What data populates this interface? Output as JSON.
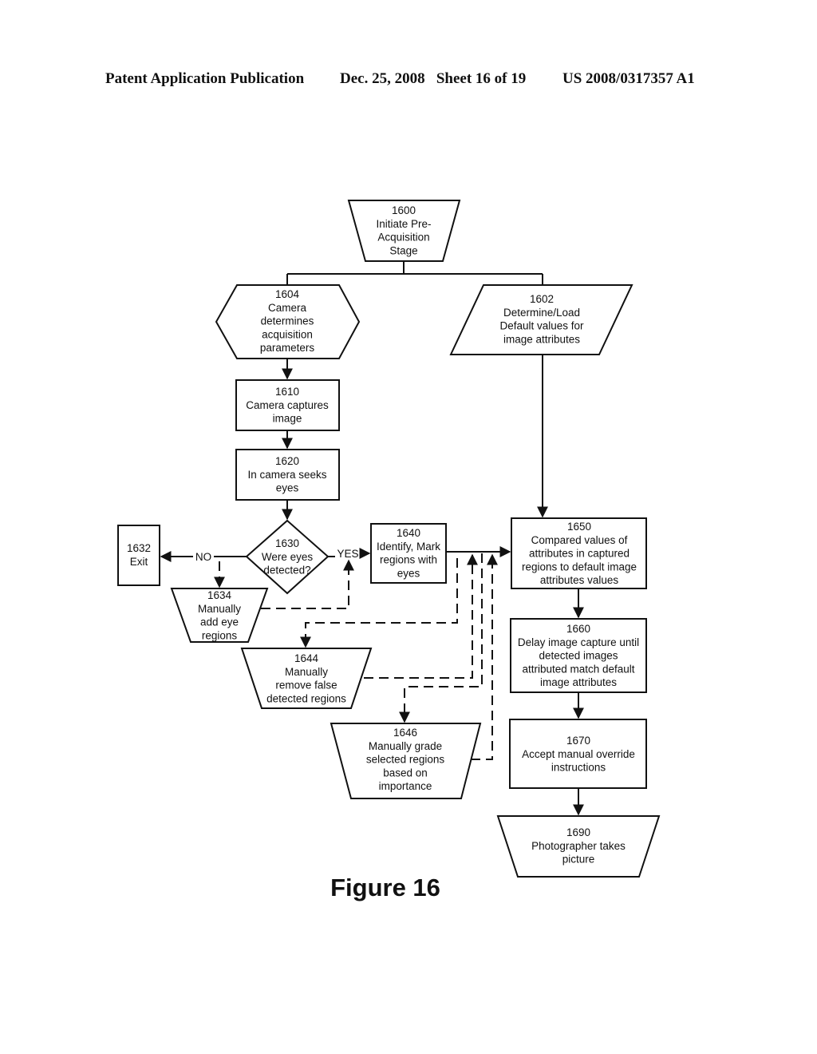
{
  "header": {
    "publication": "Patent Application Publication",
    "date_sheet": "Dec. 25, 2008   Sheet 16 of 19",
    "patent_number": "US 2008/0317357 A1"
  },
  "figure_label": "Figure 16",
  "nodes": {
    "n1600": {
      "id": "1600",
      "lines": [
        "1600",
        "Initiate Pre-",
        "Acquisition",
        "Stage"
      ]
    },
    "n1604": {
      "id": "1604",
      "lines": [
        "1604",
        "Camera",
        "determines",
        "acquisition",
        "parameters"
      ]
    },
    "n1602": {
      "id": "1602",
      "lines": [
        "1602",
        "Determine/Load",
        "Default values  for",
        "image attributes"
      ]
    },
    "n1610": {
      "id": "1610",
      "lines": [
        "1610",
        "Camera captures",
        "image"
      ]
    },
    "n1620": {
      "id": "1620",
      "lines": [
        "1620",
        "In camera seeks",
        "eyes"
      ]
    },
    "n1630": {
      "id": "1630",
      "lines": [
        "1630",
        "Were eyes",
        "detected?"
      ]
    },
    "n1632": {
      "id": "1632",
      "lines": [
        "1632",
        "Exit"
      ]
    },
    "n1634": {
      "id": "1634",
      "lines": [
        "1634",
        "Manually",
        "add eye",
        "regions"
      ]
    },
    "n1640": {
      "id": "1640",
      "lines": [
        "1640",
        "Identify, Mark",
        "regions with",
        "eyes"
      ]
    },
    "n1644": {
      "id": "1644",
      "lines": [
        "1644",
        "Manually",
        "remove false",
        "detected regions"
      ]
    },
    "n1646": {
      "id": "1646",
      "lines": [
        "1646",
        "Manually grade",
        "selected regions",
        "based on",
        "importance"
      ]
    },
    "n1650": {
      "id": "1650",
      "lines": [
        "1650",
        "Compared values of",
        "attributes in captured",
        "regions to default image",
        "attributes values"
      ]
    },
    "n1660": {
      "id": "1660",
      "lines": [
        "1660",
        "Delay image capture until",
        "detected images",
        "attributed match default",
        "image attributes"
      ]
    },
    "n1670": {
      "id": "1670",
      "lines": [
        "1670",
        "Accept manual override",
        "instructions"
      ]
    },
    "n1690": {
      "id": "1690",
      "lines": [
        "1690",
        "Photographer takes",
        "picture"
      ]
    }
  },
  "edge_labels": {
    "no": "NO",
    "yes": "YES"
  }
}
